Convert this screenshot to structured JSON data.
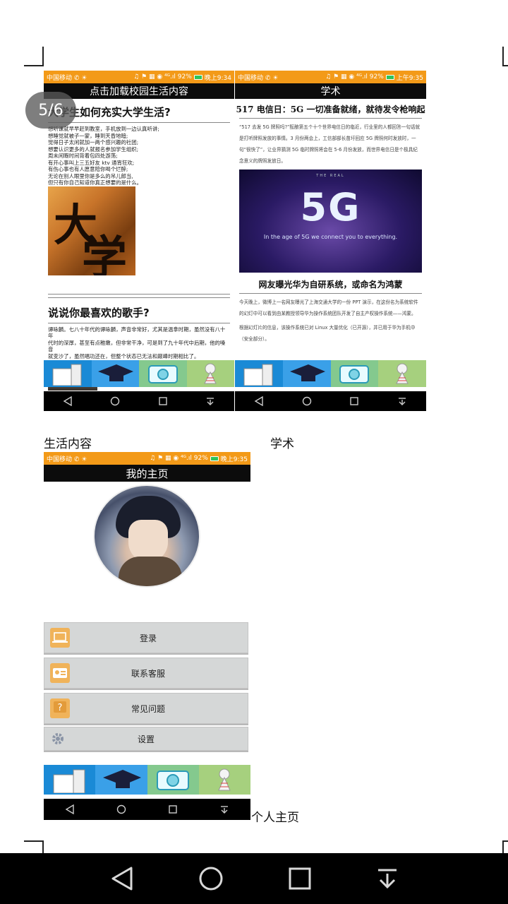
{
  "viewer": {
    "page_indicator": "5/6"
  },
  "screen_left": {
    "status": {
      "carrier": "中国移动 ✆ ☀",
      "icons": "♫ ⚑ ▦ ◉ ⁴ᴳ.ıl 92%",
      "time": "晚上9:34"
    },
    "title": "点击加载校园生活内容",
    "article1": {
      "title": "大学生如何充实大学生活?",
      "lines": [
        "想听课就早早赶到教室，手机放到一边认真听讲;",
        "想睡觉就被子一蒙，睡到天昏地暗;",
        "觉得日子太闲就加一两个感兴趣的社团;",
        "想要认识更多的人就报名参加学生组织;",
        "周末闲暇时间背着包四处游荡;",
        "有开心事叫上三五好友 ktv 通宵狂欢;",
        "有伤心事也有人愿意陪你喝个烂醉;",
        "无论在别人眼里你是多么的吊儿郎当,",
        "但只有你自己知道你真正想要的是什么。"
      ],
      "image_glyphs": [
        "大",
        "学"
      ]
    },
    "article2": {
      "title": "说说你最喜欢的歌手?",
      "lines": [
        "谭咏麟。七八十年代的谭咏麟，声音非常好，尤其是温拿时期，虽然没有八十年",
        "代时的深厚，甚至有点稚嫩，但非常干净，可是到了九十年代中后期，他的嗓音",
        "就变沙了，虽然唱功还在，但整个状态已无法和巅峰时期相比了。"
      ]
    }
  },
  "screen_right": {
    "status": {
      "carrier": "中国移动 ✆ ☀",
      "icons": "♫ ⚑ ▦ ◉ ⁴ᴳ.ıl 92%",
      "time": "上午9:35"
    },
    "title": "学术",
    "news1": {
      "title": "517 电信日：5G 一切准备就绪，就待发令枪响起",
      "paragraph": "“517 去发 5G 牌照吗?”酝酿第五个十个世界电信日的临近，行业里的人都回答一句话就是打听牌照发放的事情。3 月份两会上，工信部部长苗圩回应 5G 牌照何时发放时，一句“很快了”，让业界猜测 5G 临时牌照将会在 5-6 月份发放，而世界电信日是个极具纪念意义的牌照发放日。",
      "image_top": "THE REAL",
      "image_big": "5G",
      "image_sub": "In the age of 5G we connect you to everything."
    },
    "news2": {
      "title": "网友曝光华为自研系统，或命名为鸿蒙",
      "paragraph1": "今天晚上，微博上一名网友曝光了上海交通大学的一份 PPT 演示，在这份名为系统软件的幻灯中可以看到由某教授领导华为操作系统团队开发了自主产权操作系统——鸿蒙。",
      "paragraph2": "根据幻灯片的信息，该操作系统已对 Linux 大量优化（已开源），并已用于华为手机中（安全部分）。"
    }
  },
  "caption_left": "生活内容",
  "caption_right": "学术",
  "screen_bottom": {
    "status": {
      "carrier": "中国移动 ✆ ☀",
      "icons": "♫ ⚑ ▦ ◉ ⁴ᴳ.ıl 92%",
      "time": "晚上9:35"
    },
    "title": "我的主页",
    "menu": [
      {
        "label": "登录",
        "icon": "laptop-icon"
      },
      {
        "label": "联系客服",
        "icon": "contact-card-icon"
      },
      {
        "label": "常见问题",
        "icon": "question-icon"
      },
      {
        "label": "设置",
        "icon": "gear-icon"
      }
    ]
  },
  "caption_bottom": "个人主页",
  "tabs": [
    {
      "name": "buildings-icon"
    },
    {
      "name": "graduation-cap-icon"
    },
    {
      "name": "camera-icon"
    },
    {
      "name": "award-icon"
    }
  ],
  "colors": {
    "status_orange": "#f39a18",
    "title_black": "#0c0c0c",
    "menu_grey": "#d5d7d7",
    "icon_orange": "#f0b35a"
  }
}
